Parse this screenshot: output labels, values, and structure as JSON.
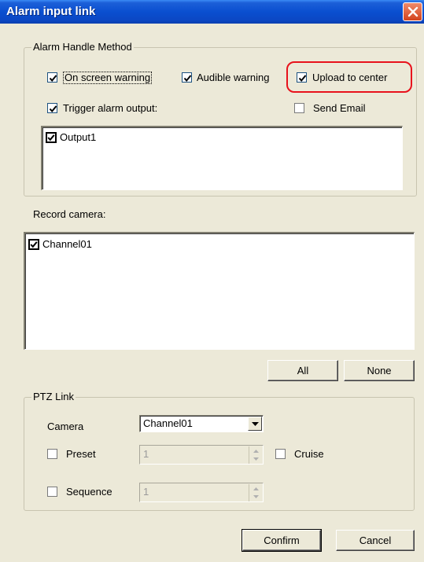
{
  "window": {
    "title": "Alarm input link"
  },
  "alarm_handle": {
    "legend": "Alarm Handle Method",
    "on_screen_warning": {
      "label": "On screen warning",
      "checked": true
    },
    "audible_warning": {
      "label": "Audible warning",
      "checked": true
    },
    "upload_to_center": {
      "label": "Upload to center",
      "checked": true
    },
    "trigger_alarm_output": {
      "label": "Trigger alarm output:",
      "checked": true
    },
    "send_email": {
      "label": "Send Email",
      "checked": false
    },
    "outputs": [
      {
        "label": "Output1",
        "checked": true
      }
    ]
  },
  "record_camera": {
    "label": "Record camera:",
    "channels": [
      {
        "label": "Channel01",
        "checked": true
      }
    ],
    "all_label": "All",
    "none_label": "None"
  },
  "ptz_link": {
    "legend": "PTZ Link",
    "camera_label": "Camera",
    "camera_value": "Channel01",
    "preset": {
      "label": "Preset",
      "checked": false,
      "value": "1"
    },
    "cruise": {
      "label": "Cruise",
      "checked": false
    },
    "sequence": {
      "label": "Sequence",
      "checked": false,
      "value": "1"
    }
  },
  "buttons": {
    "confirm": "Confirm",
    "cancel": "Cancel"
  },
  "colors": {
    "title_bar": "#0a4fd0",
    "dialog_bg": "#ece9d8",
    "highlight": "#e8121c"
  }
}
